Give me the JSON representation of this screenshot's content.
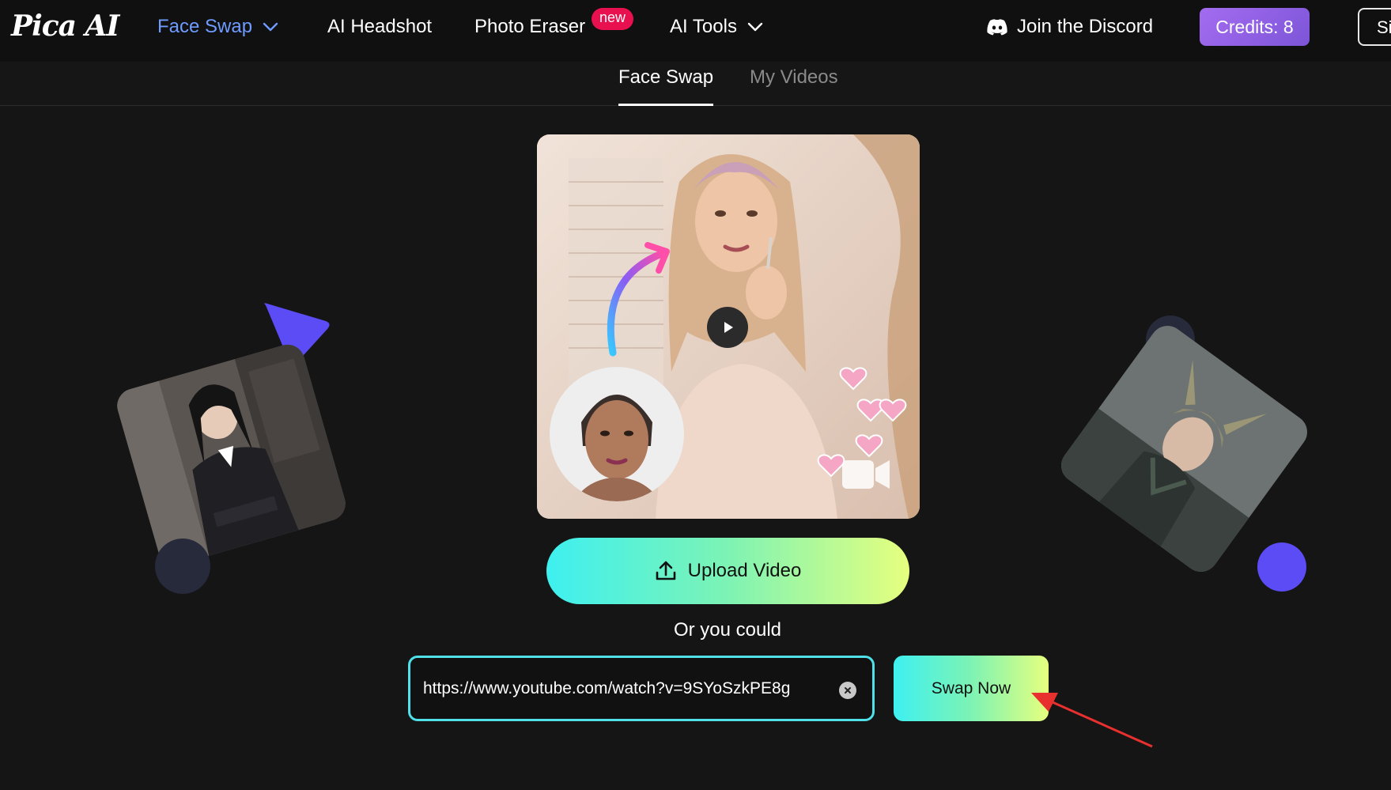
{
  "header": {
    "logo": "Pica AI",
    "nav": [
      {
        "label": "Face Swap",
        "active": true,
        "has_dropdown": true
      },
      {
        "label": "AI Headshot",
        "active": false,
        "has_dropdown": false
      },
      {
        "label": "Photo Eraser",
        "active": false,
        "has_dropdown": false,
        "badge": "new"
      },
      {
        "label": "AI Tools",
        "active": false,
        "has_dropdown": true
      }
    ],
    "discord_label": "Join the Discord",
    "credits_label": "Credits: 8",
    "signin_label": "Si"
  },
  "tabs": [
    {
      "label": "Face Swap",
      "active": true
    },
    {
      "label": "My Videos",
      "active": false
    }
  ],
  "main": {
    "upload_label": "Upload Video",
    "or_text": "Or you could",
    "url_value": "https://www.youtube.com/watch?v=9SYoSzkPE8g",
    "swap_label": "Swap Now"
  },
  "colors": {
    "accent_nav": "#6f9bff",
    "badge": "#e8104e",
    "credits": "#8e5fe3",
    "input_border": "#4fe0ea",
    "shape_purple": "#5b4cf5",
    "annotation_arrow": "#e8302f"
  },
  "icons": {
    "discord": "discord-icon",
    "chevron": "chevron-down-icon",
    "upload": "upload-icon",
    "clear": "close-circle-icon",
    "play": "play-icon"
  }
}
